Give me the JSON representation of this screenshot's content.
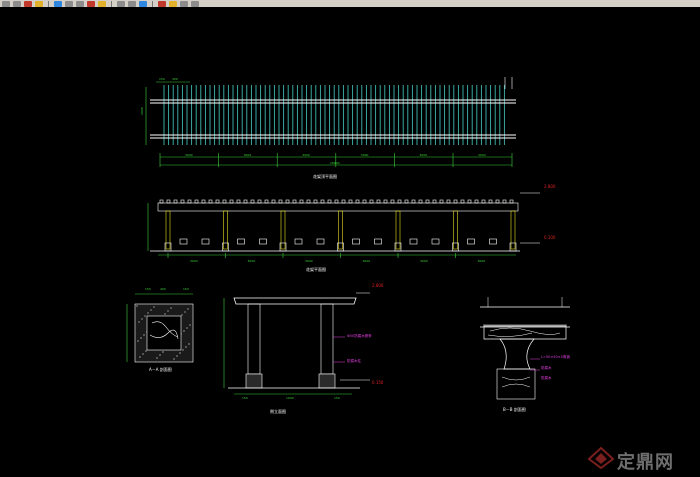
{
  "toolbar": {
    "buttons": [
      "new-file-icon",
      "open-icon",
      "save-icon",
      "print-icon",
      "zoom-in-icon",
      "zoom-out-icon",
      "zoom-window-icon",
      "zoom-extents-icon",
      "pan-icon",
      "undo-icon",
      "redo-icon",
      "layer-icon",
      "properties-icon",
      "match-icon",
      "block-icon",
      "help-icon"
    ]
  },
  "drawing": {
    "plan": {
      "title": "花架顶平面图",
      "dim_top": [
        "150",
        "300"
      ],
      "dim_side": "2000",
      "dim_bays": [
        "3000",
        "3000",
        "3000",
        "3000",
        "3000",
        "3000"
      ],
      "dim_total": "18000"
    },
    "elevation": {
      "title": "花架平面图",
      "level_top": "2.800",
      "level_bottom": "0.100",
      "dim_bays": [
        "3000",
        "3000",
        "3000",
        "3000",
        "3000",
        "3000"
      ]
    },
    "section_aa": {
      "title": "A－A 剖面图",
      "dims": [
        "150",
        "400",
        "150"
      ]
    },
    "side": {
      "title": "侧立面图",
      "level_top": "2.800",
      "level_bottom": "0.150",
      "note1": "Φ50防腐木檩条",
      "note2": "防腐木柱",
      "dims": [
        "150",
        "1900",
        "150"
      ]
    },
    "section_bb": {
      "title": "B－B 剖面图",
      "note1": "L=50×50×5角钢",
      "note2": "防腐木",
      "note3": "防腐木"
    }
  },
  "watermark": {
    "text": "定鼎网"
  },
  "colors": {
    "background": "#000000",
    "line_white": "#ffffff",
    "line_cyan": "#3fb8b0",
    "line_yellow": "#e8e020",
    "line_green": "#3bd23b",
    "line_magenta": "#e040e0",
    "line_red": "#e02020"
  }
}
